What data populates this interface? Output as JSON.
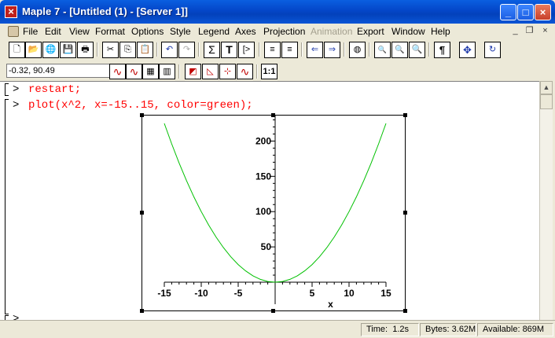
{
  "window": {
    "title": "Maple 7  - [Untitled (1) - [Server 1]]",
    "close_glyph": "×",
    "minimize_glyph": "_",
    "maximize_glyph": "□"
  },
  "menu": {
    "items": [
      {
        "label": "File"
      },
      {
        "label": "Edit"
      },
      {
        "label": "View"
      },
      {
        "label": "Format"
      },
      {
        "label": "Options"
      },
      {
        "label": "Style"
      },
      {
        "label": "Legend"
      },
      {
        "label": "Axes"
      },
      {
        "label": "Projection"
      },
      {
        "label": "Animation",
        "disabled": true
      },
      {
        "label": "Export"
      },
      {
        "label": "Window"
      },
      {
        "label": "Help"
      }
    ],
    "mdi_minimize": "_",
    "mdi_restore": "❐",
    "mdi_close": "×"
  },
  "toolbar1": {
    "new": "🗋",
    "open": "📂",
    "open_url": "🌐",
    "save": "💾",
    "print": "🖶",
    "cut": "✂",
    "copy": "⎘",
    "paste": "📋",
    "undo": "↶",
    "redo": "↷",
    "sigma": "Σ",
    "text": "T",
    "prompt": "[>",
    "indent": "≡",
    "outdent": "≡",
    "back": "⇐",
    "forward": "⇒",
    "stop": "◍",
    "zoom1": "🔍",
    "zoom2": "🔍",
    "zoom3": "🔍",
    "paragraph": "¶",
    "expand": "✥",
    "restart": "↻"
  },
  "toolbar2": {
    "coordinates": "-0.32, 90.49",
    "line": "∿",
    "line2": "∿",
    "patch": "▦",
    "patch2": "▥",
    "frame": "◩",
    "boxed": "◺",
    "normal": "⊹",
    "none": "∿",
    "scale": "1:1"
  },
  "worksheet": {
    "prompt": ">",
    "line1": "restart;",
    "line2": "plot(x^2, x=-15..15, color=green);",
    "prompt3": ">"
  },
  "status": {
    "time_label": "Time:",
    "time_value": "1.2s",
    "bytes_label": "Bytes:",
    "bytes_value": "3.62M",
    "available_label": "Available:",
    "available_value": "869M"
  },
  "chart_data": {
    "type": "line",
    "title": "",
    "xlabel": "x",
    "ylabel": "",
    "xlim": [
      -15,
      15
    ],
    "ylim": [
      0,
      225
    ],
    "x_ticks": [
      -15,
      -10,
      -5,
      5,
      10,
      15
    ],
    "y_ticks": [
      50,
      100,
      150,
      200
    ],
    "series": [
      {
        "expression": "x^2",
        "color": "#00c000",
        "x": [
          -15,
          -14,
          -13,
          -12,
          -11,
          -10,
          -9,
          -8,
          -7,
          -6,
          -5,
          -4,
          -3,
          -2,
          -1,
          0,
          1,
          2,
          3,
          4,
          5,
          6,
          7,
          8,
          9,
          10,
          11,
          12,
          13,
          14,
          15
        ],
        "y": [
          225,
          196,
          169,
          144,
          121,
          100,
          81,
          64,
          49,
          36,
          25,
          16,
          9,
          4,
          1,
          0,
          1,
          4,
          9,
          16,
          25,
          36,
          49,
          64,
          81,
          100,
          121,
          144,
          169,
          196,
          225
        ]
      }
    ]
  }
}
